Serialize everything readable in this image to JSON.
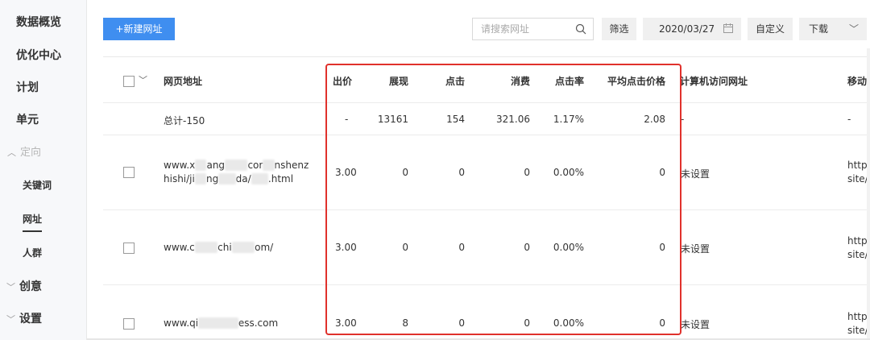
{
  "sidebar": {
    "items": [
      {
        "label": "数据概览"
      },
      {
        "label": "优化中心"
      },
      {
        "label": "计划"
      },
      {
        "label": "单元"
      },
      {
        "label": "定向"
      },
      {
        "label": "关键词"
      },
      {
        "label": "网址"
      },
      {
        "label": "人群"
      },
      {
        "label": "创意"
      },
      {
        "label": "设置"
      }
    ]
  },
  "toolbar": {
    "new_label": "+新建网址",
    "search_placeholder": "请搜索网址",
    "filter_label": "筛选",
    "date": "2020/03/27",
    "custom_label": "自定义",
    "download_label": "下载"
  },
  "table": {
    "headers": [
      "网页地址",
      "出价",
      "展现",
      "点击",
      "消费",
      "点击率",
      "平均点击价格",
      "计算机访问网址",
      "移动"
    ],
    "total": {
      "label": "总计-150",
      "bid": "-",
      "impressions": "13161",
      "clicks": "154",
      "cost": "321.06",
      "ctr": "1.17%",
      "avg_cpc": "2.08",
      "pc_url": "-",
      "mobile": "-"
    },
    "rows": [
      {
        "url_line1_a": "www.x",
        "url_line1_b": "ang",
        "url_line1_c": "cor",
        "url_line1_d": "nshenz",
        "url_line2_a": "hishi/ji",
        "url_line2_b": "ng",
        "url_line2_c": "da/",
        "url_line2_d": ".html",
        "bid": "3.00",
        "impressions": "0",
        "clicks": "0",
        "cost": "0",
        "ctr": "0.00%",
        "avg_cpc": "0",
        "pc_url": "未设置",
        "mobile_1": "http",
        "mobile_2": "site/"
      },
      {
        "url_a": "www.c",
        "url_b": "chi",
        "url_c": "om/",
        "bid": "3.00",
        "impressions": "0",
        "clicks": "0",
        "cost": "0",
        "ctr": "0.00%",
        "avg_cpc": "0",
        "pc_url": "未设置",
        "mobile_1": "http",
        "mobile_2": "site/"
      },
      {
        "url_a": "www.qi",
        "url_c": "ess.com",
        "bid": "3.00",
        "impressions": "8",
        "clicks": "0",
        "cost": "0",
        "ctr": "0.00%",
        "avg_cpc": "0",
        "pc_url": "未设置",
        "mobile_1": "http",
        "mobile_2": "site/"
      }
    ]
  },
  "colors": {
    "primary": "#3f8ef0",
    "highlight": "#e0312c",
    "sidebar_bg": "#f7f8fa"
  },
  "icons": [
    "search-icon",
    "calendar-icon",
    "chevron-down-icon",
    "chevron-right-icon"
  ]
}
